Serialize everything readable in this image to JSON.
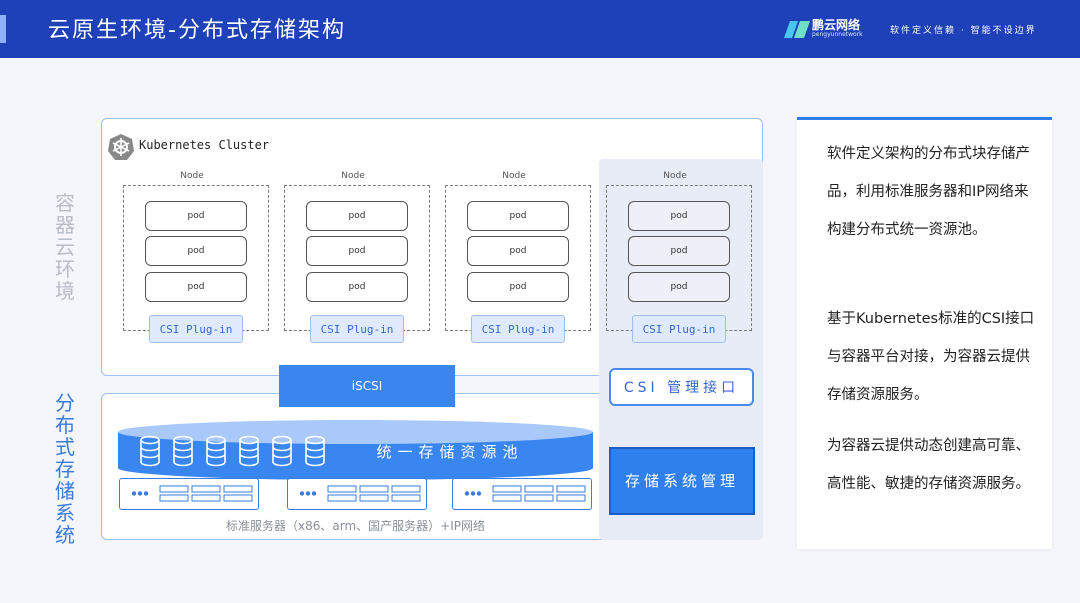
{
  "header": {
    "title": "云原生环境-分布式存储架构",
    "logo_name": "鹏云网络",
    "logo_sub": "pengyunnetwork",
    "slogan": "软件定义信赖 · 智能不设边界"
  },
  "side_labels": {
    "container_env": "容器云环境",
    "storage_system": "分布式存储系统"
  },
  "cluster": {
    "title": "Kubernetes Cluster",
    "nodes": [
      {
        "label": "Node",
        "pods": [
          "pod",
          "pod",
          "pod"
        ],
        "plugin": "CSI Plug-in"
      },
      {
        "label": "Node",
        "pods": [
          "pod",
          "pod",
          "pod"
        ],
        "plugin": "CSI Plug-in"
      },
      {
        "label": "Node",
        "pods": [
          "pod",
          "pod",
          "pod"
        ],
        "plugin": "CSI Plug-in"
      },
      {
        "label": "Node",
        "pods": [
          "pod",
          "pod",
          "pod"
        ],
        "plugin": "CSI Plug-in"
      }
    ]
  },
  "storage": {
    "iscsi": "iSCSI",
    "csi_mgmt": "CSI 管理接口",
    "pool": "统一存储资源池",
    "mgmt": "存储系统管理",
    "servers_caption": "标准服务器（x86、arm、国产服务器）+IP网络"
  },
  "card": {
    "paragraphs": [
      "软件定义架构的分布式块存储产品，利用标准服务器和IP网络来构建分布式统一资源池。",
      "基于Kubernetes标准的CSI接口与容器平台对接，为容器云提供存储资源服务。",
      "为容器云提供动态创建高可靠、高性能、敏捷的存储资源服务。"
    ]
  },
  "colors": {
    "header": "#1e40b8",
    "accent": "#2f80ed",
    "panel_border": "#9dc0ff"
  }
}
